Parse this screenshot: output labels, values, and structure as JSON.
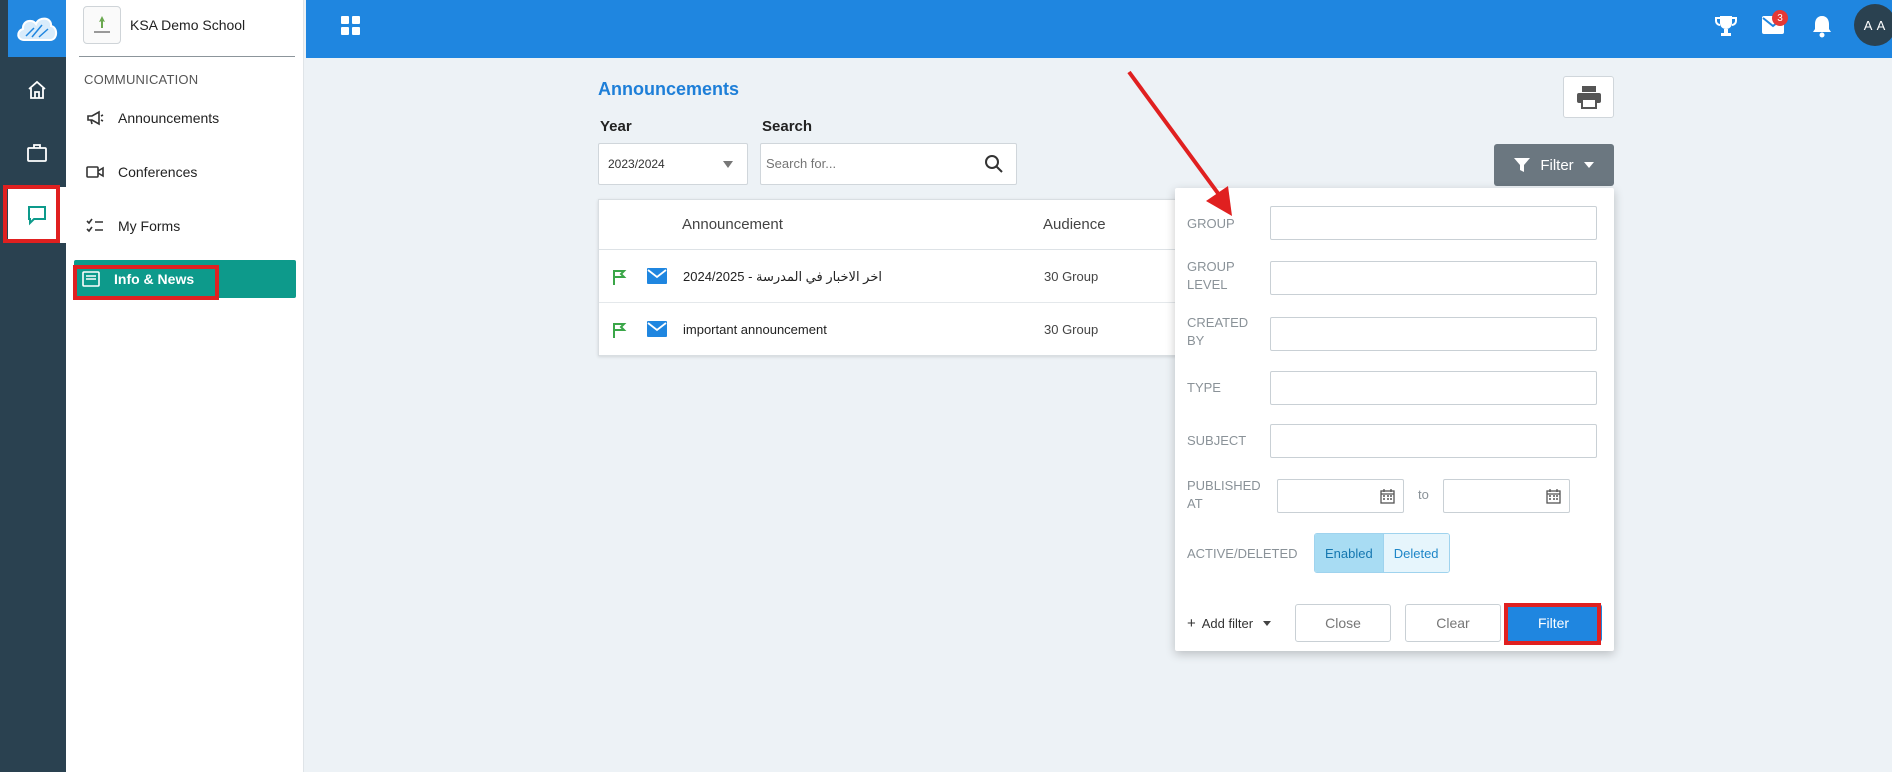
{
  "sidebar": {
    "school_name": "KSA Demo School",
    "section_title": "COMMUNICATION",
    "items": [
      {
        "label": "Announcements",
        "icon": "megaphone-icon"
      },
      {
        "label": "Conferences",
        "icon": "video-icon"
      },
      {
        "label": "My Forms",
        "icon": "checklist-icon"
      },
      {
        "label": "Info & News",
        "icon": "news-icon",
        "active": true
      }
    ]
  },
  "topbar": {
    "messages_badge": "3",
    "avatar_initials": "A A"
  },
  "page": {
    "title": "Announcements",
    "year_label": "Year",
    "year_value": "2023/2024",
    "search_label": "Search",
    "search_placeholder": "Search for...",
    "filter_button": "Filter"
  },
  "table": {
    "columns": [
      "Announcement",
      "Audience"
    ],
    "rows": [
      {
        "title": "اخر الاخبار في المدرسة - 2024/2025",
        "audience": "30 Group"
      },
      {
        "title": "important announcement",
        "audience": "30 Group"
      }
    ]
  },
  "filter_panel": {
    "labels": {
      "group": "GROUP",
      "group_level_1": "GROUP",
      "group_level_2": "LEVEL",
      "created_by_1": "CREATED",
      "created_by_2": "BY",
      "type": "TYPE",
      "subject": "SUBJECT",
      "published_at_1": "PUBLISHED",
      "published_at_2": "AT",
      "to": "to",
      "active_deleted": "ACTIVE/DELETED"
    },
    "toggle": {
      "enabled": "Enabled",
      "deleted": "Deleted",
      "selected": "Enabled"
    },
    "add_filter": "Add filter",
    "close": "Close",
    "clear": "Clear",
    "submit": "Filter"
  },
  "colors": {
    "topbar": "#1f86e0",
    "rail": "#2a4150",
    "active_nav": "#0d9a8b",
    "annotation": "#e02020"
  }
}
